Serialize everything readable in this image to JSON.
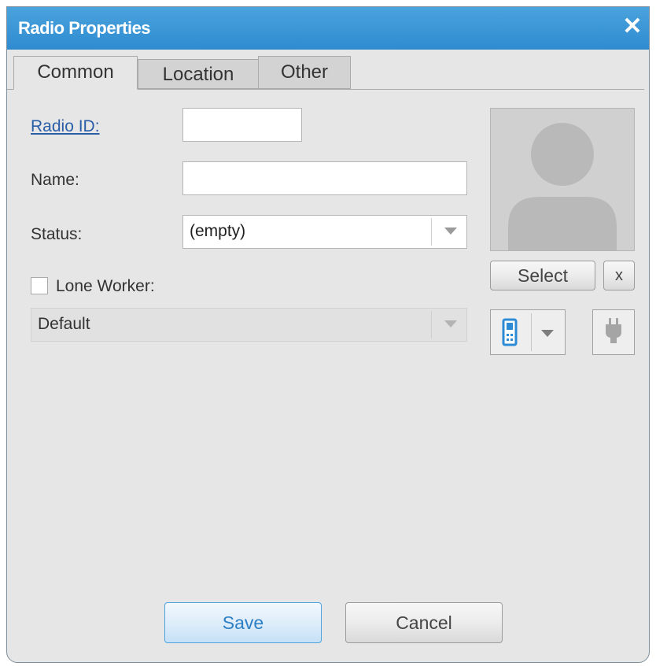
{
  "window": {
    "title": "Radio Properties",
    "close_glyph": "✕"
  },
  "tabs": [
    {
      "label": "Common",
      "active": true
    },
    {
      "label": "Location",
      "active": false
    },
    {
      "label": "Other",
      "active": false
    }
  ],
  "form": {
    "radio_id": {
      "label": "Radio ID:",
      "value": ""
    },
    "name": {
      "label": "Name:",
      "value": ""
    },
    "status": {
      "label": "Status:",
      "value": "(empty)"
    },
    "lone_worker": {
      "label": "Lone Worker:",
      "checked": false,
      "profile": "Default"
    }
  },
  "photo": {
    "select_label": "Select",
    "clear_label": "x",
    "device_icon": "mobile-radio-icon",
    "connect_icon": "plug-icon"
  },
  "footer": {
    "save_label": "Save",
    "cancel_label": "Cancel"
  },
  "colors": {
    "title_bar": "#3a96d6",
    "primary_text": "#2d7fc3",
    "link": "#2a5fa8"
  }
}
